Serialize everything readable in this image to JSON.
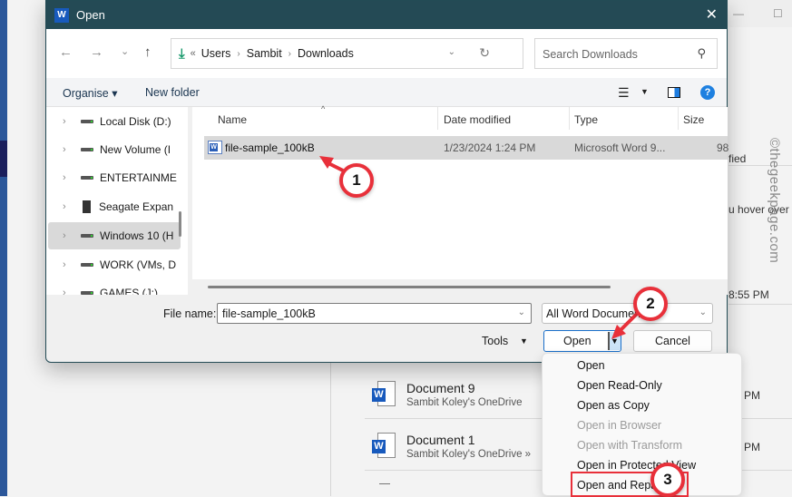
{
  "background_window": {
    "partial_texts": [
      "fied",
      "u hover over",
      "8:55 PM",
      "PM",
      "PM"
    ],
    "recent_docs": [
      {
        "title": "Document 9",
        "location": "Sambit Koley's OneDrive"
      },
      {
        "title": "Document 1",
        "location": "Sambit Koley's OneDrive »"
      }
    ],
    "watermark": "©thegeekpage.com"
  },
  "dialog": {
    "title": "Open",
    "app_icon": "word-icon",
    "close_label": "✕",
    "nav": {
      "back": "←",
      "forward": "→",
      "recent": "⌄",
      "up": "↑"
    },
    "address": {
      "overflow": "«",
      "crumbs": [
        "Users",
        "Sambit",
        "Downloads"
      ]
    },
    "search": {
      "placeholder": "Search Downloads"
    },
    "command_bar": {
      "organise": "Organise ▾",
      "new_folder": "New folder"
    },
    "tree": [
      {
        "label": "Local Disk (D:)",
        "icon": "drive-icon",
        "selected": false
      },
      {
        "label": "New Volume (I",
        "icon": "drive-icon",
        "selected": false
      },
      {
        "label": "ENTERTAINME",
        "icon": "drive-icon",
        "selected": false
      },
      {
        "label": "Seagate Expan",
        "icon": "external-drive-icon",
        "selected": false
      },
      {
        "label": "Windows 10 (H",
        "icon": "drive-icon",
        "selected": true
      },
      {
        "label": "WORK (VMs, D",
        "icon": "drive-icon",
        "selected": false
      },
      {
        "label": "GAMES (J:)",
        "icon": "drive-icon",
        "selected": false
      }
    ],
    "columns": [
      "Name",
      "Date modified",
      "Type",
      "Size"
    ],
    "files": [
      {
        "name": "file-sample_100kB",
        "date_modified": "1/23/2024 1:24 PM",
        "type": "Microsoft Word 9...",
        "size": "98",
        "selected": true
      }
    ],
    "file_name_label": "File name:",
    "file_name_value": "file-sample_100kB",
    "file_type_filter": "All Word Documents",
    "tools_label": "Tools",
    "open_label": "Open",
    "cancel_label": "Cancel",
    "open_menu": [
      {
        "label": "Open",
        "enabled": true
      },
      {
        "label": "Open Read-Only",
        "enabled": true
      },
      {
        "label": "Open as Copy",
        "enabled": true
      },
      {
        "label": "Open in Browser",
        "enabled": false
      },
      {
        "label": "Open with Transform",
        "enabled": false
      },
      {
        "label": "Open in Protected View",
        "enabled": true
      },
      {
        "label": "Open and Repair",
        "enabled": true
      }
    ]
  },
  "annotations": {
    "step1": "1",
    "step2": "2",
    "step3": "3",
    "color": "#e8303a"
  }
}
